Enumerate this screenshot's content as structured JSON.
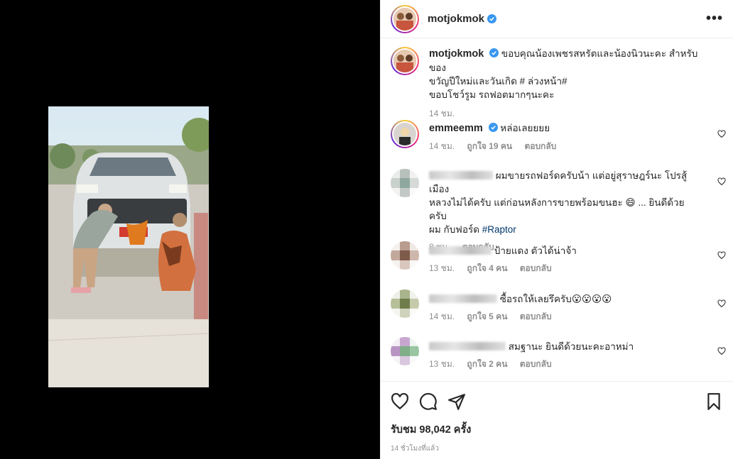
{
  "header": {
    "username": "motjokmok",
    "more_label": "•••"
  },
  "caption": {
    "username": "motjokmok",
    "lines": [
      "ขอบคุณน้องเพชรสหรัตและน้องนิวนะคะ สำหรับของ",
      "ขวัญปีใหม่และวันเกิด # ล่วงหน้า#",
      "ขอบโชว์รูม รถฟอตมากๆนะคะ"
    ],
    "time": "14 ชม."
  },
  "comments": [
    {
      "username": "emmeemm",
      "verified": true,
      "text": "หล่อเลยยยย",
      "time": "14 ชม.",
      "likes": "ถูกใจ 19 คน",
      "reply": "ตอบกลับ"
    },
    {
      "username": "",
      "text_l1": "ผมขายรถฟอร์ดครับน้า แต่อยู่สุราษฎร์นะ โปรสู้เมือง",
      "text_l2": "หลวงไม่ได้ครับ แต่ก่อนหลังการขายพร้อมขนฮะ 😄 ... ยินดีด้วยครับ",
      "text_l3": "ผม กับฟอร์ด",
      "hashtag": "#Raptor",
      "time": "8 ชม.",
      "reply": "ตอบกลับ"
    },
    {
      "username": "",
      "text": "ป้ายแดง ตัวได้น่าจ้า",
      "time": "13 ชม.",
      "likes": "ถูกใจ 4 คน",
      "reply": "ตอบกลับ"
    },
    {
      "username": "",
      "text": "ซื้อรถให้เลยรึครับ😮😮😮😮",
      "time": "14 ชม.",
      "likes": "ถูกใจ 5 คน",
      "reply": "ตอบกลับ"
    },
    {
      "username": "",
      "text": "สมฐานะ ยินดีด้วยนะคะอาหม่า",
      "time": "13 ชม.",
      "likes": "ถูกใจ 2 คน",
      "reply": "ตอบกลับ"
    }
  ],
  "footer": {
    "views": "รับชม 98,042 ครั้ง",
    "time_ago": "14 ชั่วโมงที่แล้ว"
  },
  "colors": {
    "verified": "#3897f0",
    "link": "#00376b",
    "muted": "#8e8e8e"
  }
}
